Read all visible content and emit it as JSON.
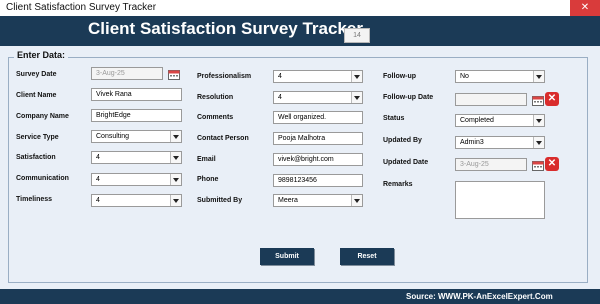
{
  "window": {
    "title": "Client Satisfaction Survey Tracker"
  },
  "header": {
    "title": "Client Satisfaction Survey Tracker",
    "record_id": "14"
  },
  "form": {
    "legend": "Enter Data:",
    "survey_date": {
      "label": "Survey Date",
      "value": "3-Aug-25"
    },
    "client_name": {
      "label": "Client Name",
      "value": "Vivek Rana"
    },
    "company_name": {
      "label": "Company Name",
      "value": "BrightEdge"
    },
    "service_type": {
      "label": "Service Type",
      "value": "Consulting"
    },
    "satisfaction": {
      "label": "Satisfaction",
      "value": "4"
    },
    "communication": {
      "label": "Communication",
      "value": "4"
    },
    "timeliness": {
      "label": "Timeliness",
      "value": "4"
    },
    "professionalism": {
      "label": "Professionalism",
      "value": "4"
    },
    "resolution": {
      "label": "Resolution",
      "value": "4"
    },
    "comments": {
      "label": "Comments",
      "value": "Well organized."
    },
    "contact_person": {
      "label": "Contact Person",
      "value": "Pooja Malhotra"
    },
    "email": {
      "label": "Email",
      "value": "vivek@bright.com"
    },
    "phone": {
      "label": "Phone",
      "value": "9898123456"
    },
    "submitted_by": {
      "label": "Submitted By",
      "value": "Meera"
    },
    "follow_up": {
      "label": "Follow-up",
      "value": "No"
    },
    "follow_up_date": {
      "label": "Follow-up Date",
      "value": ""
    },
    "status": {
      "label": "Status",
      "value": "Completed"
    },
    "updated_by": {
      "label": "Updated By",
      "value": "Admin3"
    },
    "updated_date": {
      "label": "Updated Date",
      "value": "3-Aug-25"
    },
    "remarks": {
      "label": "Remarks",
      "value": ""
    }
  },
  "buttons": {
    "submit": "Submit",
    "reset": "Reset"
  },
  "footer": {
    "source": "Source: WWW.PK-AnExcelExpert.Com"
  },
  "colors": {
    "header_bg": "#1b3a56",
    "panel_bg": "#e9eff7",
    "clear_red": "#d92c2c"
  }
}
